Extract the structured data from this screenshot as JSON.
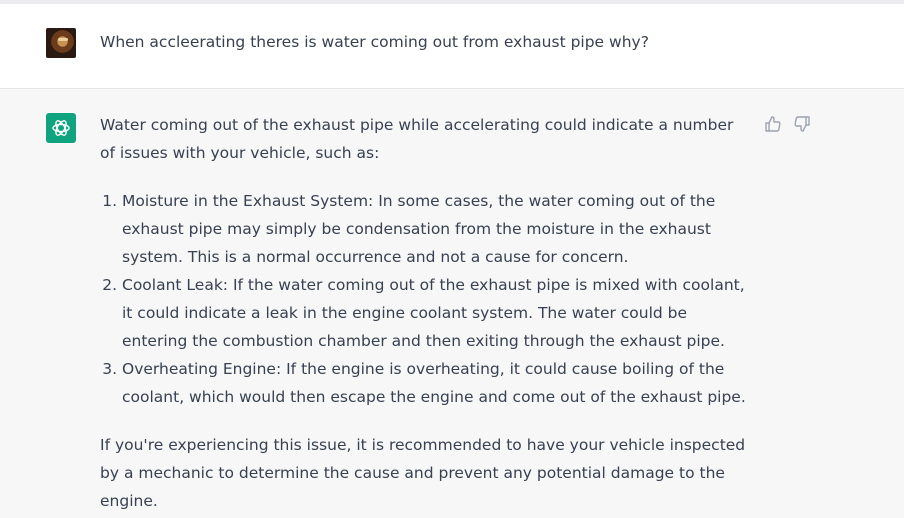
{
  "user_message": {
    "text": "When accleerating theres is water coming out from exhaust pipe why?"
  },
  "assistant_message": {
    "intro": "Water coming out of the exhaust pipe while accelerating could indicate a number of issues with your vehicle, such as:",
    "items": [
      "Moisture in the Exhaust System: In some cases, the water coming out of the exhaust pipe may simply be condensation from the moisture in the exhaust system. This is a normal occurrence and not a cause for concern.",
      "Coolant Leak: If the water coming out of the exhaust pipe is mixed with coolant, it could indicate a leak in the engine coolant system. The water could be entering the combustion chamber and then exiting through the exhaust pipe.",
      "Overheating Engine: If the engine is overheating, it could cause boiling of the coolant, which would then escape the engine and come out of the exhaust pipe."
    ],
    "outro": "If you're experiencing this issue, it is recommended to have your vehicle inspected by a mechanic to determine the cause and prevent any potential damage to the engine."
  },
  "icons": {
    "user_avatar": "user-avatar",
    "assistant_logo": "openai-logo-icon",
    "thumbs_up": "thumbs-up-icon",
    "thumbs_down": "thumbs-down-icon"
  },
  "colors": {
    "assistant_logo_bg": "#10a37f",
    "assistant_row_bg": "#f7f7f8"
  }
}
